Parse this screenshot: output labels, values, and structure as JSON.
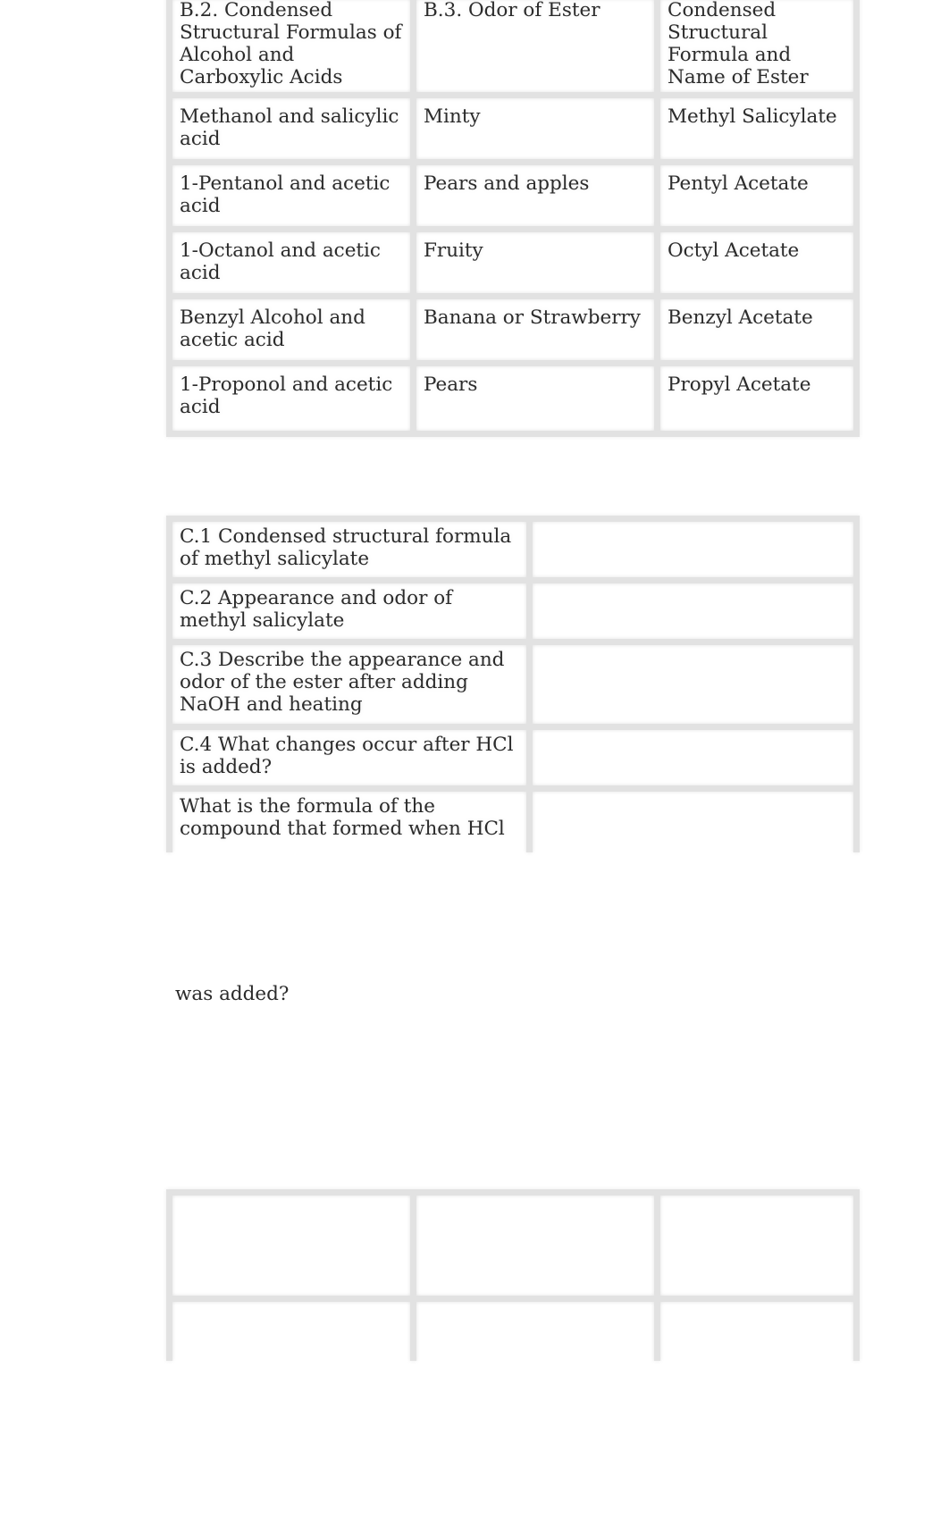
{
  "table_b": {
    "headers": [
      "B.2. Condensed Structural Formulas of Alcohol and Carboxylic Acids",
      "B.3. Odor of Ester",
      "Condensed Structural Formula and Name of Ester"
    ],
    "rows": [
      [
        "Methanol and salicylic acid",
        "Minty",
        "Methyl Salicylate"
      ],
      [
        "1-Pentanol and acetic acid",
        "Pears and apples",
        "Pentyl Acetate"
      ],
      [
        "1-Octanol and acetic acid",
        "Fruity",
        "Octyl Acetate"
      ],
      [
        "Benzyl Alcohol and acetic acid",
        "Banana or Strawberry",
        "Benzyl Acetate"
      ],
      [
        "1-Proponol and acetic acid",
        "Pears",
        "Propyl Acetate"
      ]
    ]
  },
  "table_c": {
    "rows": [
      "C.1 Condensed structural formula of methyl salicylate",
      "C.2 Appearance and odor of methyl salicylate",
      "C.3 Describe the appearance and odor of the ester after adding NaOH and heating",
      "C.4 What changes occur after HCl is added?",
      "What is the formula of the compound that formed when HCl"
    ],
    "continuation": "was added?"
  }
}
